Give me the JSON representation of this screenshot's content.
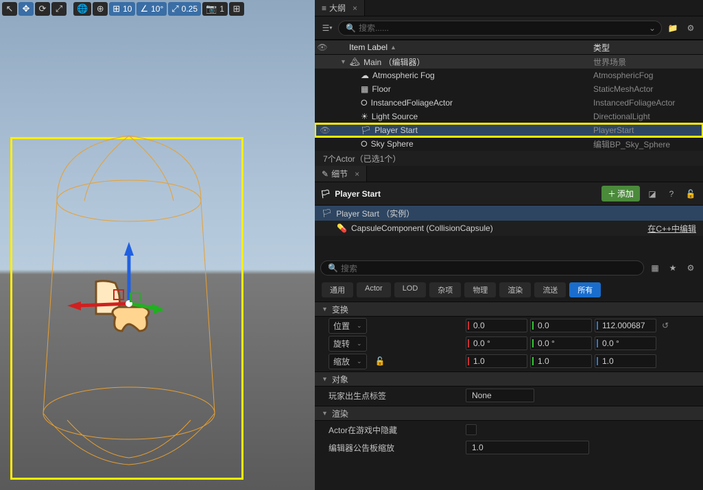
{
  "toolbar": {
    "grid_snap": "10",
    "angle_snap": "10°",
    "scale_snap": "0.25",
    "camera_speed": "1"
  },
  "outliner": {
    "tab_title": "大纲",
    "search_placeholder": "搜索......",
    "header_label": "Item Label",
    "header_type": "类型",
    "root": {
      "label": "Main （编辑器）",
      "type": "世界场景"
    },
    "items": [
      {
        "label": "Atmospheric Fog",
        "type": "AtmosphericFog",
        "icon": "layers"
      },
      {
        "label": "Floor",
        "type": "StaticMeshActor",
        "icon": "cube"
      },
      {
        "label": "InstancedFoliageActor",
        "type": "InstancedFoliageActor",
        "icon": "circle"
      },
      {
        "label": "Light Source",
        "type": "DirectionalLight",
        "icon": "sun"
      },
      {
        "label": "Player Start",
        "type": "PlayerStart",
        "icon": "flag",
        "selected": true,
        "highlighted": true
      },
      {
        "label": "Sky Sphere",
        "type": "编辑BP_Sky_Sphere",
        "icon": "circle"
      }
    ],
    "status": "7个Actor（已选1个）"
  },
  "details": {
    "tab_title": "细节",
    "title": "Player Start",
    "add_label": "添加",
    "components": [
      {
        "label": "Player Start （实例）",
        "selected": true
      },
      {
        "label": "CapsuleComponent (CollisionCapsule)",
        "edit_link": "在C++中编辑"
      }
    ],
    "search_placeholder": "搜索",
    "filters": [
      "通用",
      "Actor",
      "LOD",
      "杂项",
      "物理",
      "渲染",
      "流送",
      "所有"
    ],
    "filters_active": "所有",
    "transform": {
      "cat": "变换",
      "location_label": "位置",
      "rotation_label": "旋转",
      "scale_label": "缩放",
      "location": [
        "0.0",
        "0.0",
        "112.000687"
      ],
      "rotation": [
        "0.0 °",
        "0.0 °",
        "0.0 °"
      ],
      "scale": [
        "1.0",
        "1.0",
        "1.0"
      ]
    },
    "object": {
      "cat": "对象",
      "spawn_tag_label": "玩家出生点标签",
      "spawn_tag_value": "None"
    },
    "rendering": {
      "cat": "渲染",
      "hidden_label": "Actor在游戏中隐藏",
      "billboard_label": "编辑器公告板缩放",
      "billboard_value": "1.0"
    }
  }
}
